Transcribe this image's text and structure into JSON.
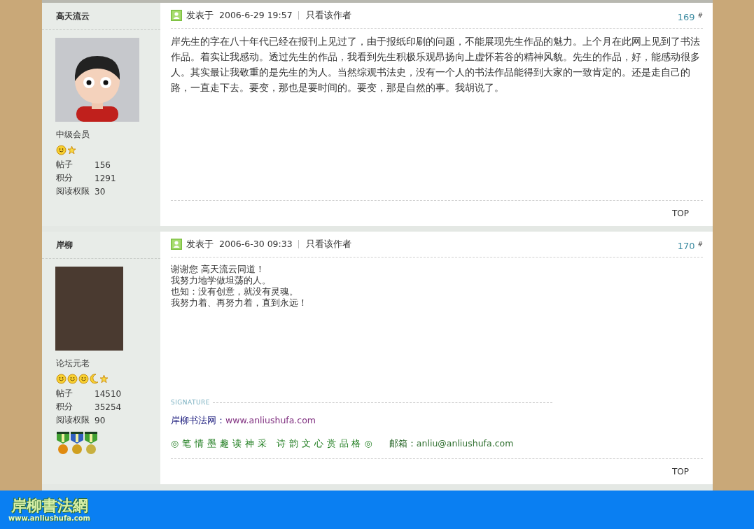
{
  "posts": [
    {
      "author": "高天流云",
      "avatar": {
        "kind": "cartoon"
      },
      "rank": "中级会员",
      "level_icons": [
        {
          "kind": "smiley"
        },
        {
          "kind": "star"
        }
      ],
      "stats": [
        {
          "label": "帖子",
          "value": "156"
        },
        {
          "label": "积分",
          "value": "1291"
        },
        {
          "label": "阅读权限",
          "value": "30"
        }
      ],
      "posted_label": "发表于",
      "time": "2006-6-29 19:57",
      "author_only": "只看该作者",
      "floor": "169",
      "floor_mark": "#",
      "body": "岸先生的字在八十年代已经在报刊上见过了，由于报纸印刷的问题，不能展现先生作品的魅力。上个月在此网上见到了书法作品。着实让我感动。透过先生的作品，我看到先生积极乐观昂扬向上虚怀若谷的精神风貌。先生的作品，好，能感动很多人。其实最让我敬重的是先生的为人。当然综观书法史，没有一个人的书法作品能得到大家的一致肯定的。还是走自己的路，一直走下去。要变，那也是要时间的。要变，那是自然的事。我胡说了。",
      "top": "TOP"
    },
    {
      "author": "岸柳",
      "avatar": {
        "kind": "photo"
      },
      "rank": "论坛元老",
      "level_icons": [
        {
          "kind": "smiley"
        },
        {
          "kind": "smiley"
        },
        {
          "kind": "smiley"
        },
        {
          "kind": "moon"
        },
        {
          "kind": "star"
        }
      ],
      "stats": [
        {
          "label": "帖子",
          "value": "14510"
        },
        {
          "label": "积分",
          "value": "35254"
        },
        {
          "label": "阅读权限",
          "value": "90"
        }
      ],
      "medals": [
        {
          "kind": "sun"
        },
        {
          "kind": "flower"
        },
        {
          "kind": "star"
        }
      ],
      "posted_label": "发表于",
      "time": "2006-6-30 09:33",
      "author_only": "只看该作者",
      "floor": "170",
      "floor_mark": "#",
      "body_lines": [
        "谢谢您  高天流云同道！",
        "我努力地学做坦荡的人。",
        "也知：没有创意，就没有灵魂。",
        "我努力着、再努力着，直到永远！"
      ],
      "signature": {
        "label": "SIGNATURE",
        "site_label": "岸柳书法网：",
        "site_link": "www.anliushufa.com",
        "motto": "◎ 笔 情 墨 趣 读 神 采   诗 韵 文 心 赏 品 格 ◎",
        "mail_label": "邮箱：",
        "mail": "anliu@anliushufa.com"
      },
      "top": "TOP"
    }
  ],
  "footer": {
    "logo_title": "岸柳書法網",
    "logo_url": "www.anliushufa.com"
  }
}
